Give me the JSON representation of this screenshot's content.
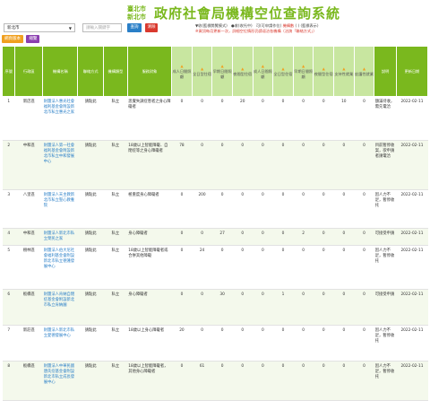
{
  "site": {
    "logo_line1": "臺北市",
    "logo_line2": "新北市",
    "title": "政府社會局機構空位查詢系統"
  },
  "filters": {
    "area_select": "新北市",
    "area_placeholder": "請輸入關鍵字",
    "query_button": "查詢",
    "clear_button": "清除"
  },
  "legend": {
    "line1_prefix": "▼收(藍標閱覽模式)　●收(收托中)　可(可申請作位)",
    "line1_red": "機構數",
    "line1_suffix": "( ) (藍標表示)",
    "line2": "※資訊每月更新一次，詳細空位情形仍請逕洽各機構（洽詢「聯絡方式」）"
  },
  "tags": {
    "tag1": "網頁版本",
    "tag2": "總覽"
  },
  "columns": [
    "序號",
    "行政區",
    "機構名稱",
    "聯絡方式",
    "機構類型",
    "服務對象",
    "成人日間照顧",
    "全日型住宿",
    "早期日間照顧",
    "夜間型住宿",
    "成人日間照顧",
    "全日型住宿",
    "早期日間照顧",
    "夜間型住宿",
    "支持性就業",
    "庇護性就業",
    "說明",
    "更新日期"
  ],
  "rows": [
    {
      "no": "1",
      "district": "新店區",
      "org": "財團法人惠光社會福利基金會附設新北市私立惠光之家",
      "contact": "請點此",
      "type": "私立",
      "target": "思覺失調症患者之身心障礙者",
      "c1": "0",
      "c2": "0",
      "c3": "0",
      "c4": "20",
      "c5": "0",
      "c6": "0",
      "c7": "0",
      "c8": "0",
      "c9": "10",
      "c10": "0",
      "note": "額滿待收，需先電洽",
      "date": "2022-02-11"
    },
    {
      "no": "2",
      "district": "中和區",
      "org": "財團法人第一社會福利基金會附設新北市私立中和發展中心",
      "contact": "請點此",
      "type": "私立",
      "target": "18歲以上智能障礙、自閉症等之身心障礙者",
      "c1": "78",
      "c2": "0",
      "c3": "0",
      "c4": "0",
      "c5": "0",
      "c6": "0",
      "c7": "0",
      "c8": "0",
      "c9": "0",
      "c10": "0",
      "note": "目前暫停收案，欲申請者請電洽",
      "date": "2022-02-11"
    },
    {
      "no": "3",
      "district": "八里區",
      "org": "財團法人天主教新北市私立聖心教養院",
      "contact": "請點此",
      "type": "私立",
      "target": "極重度身心障礙者",
      "c1": "0",
      "c2": "200",
      "c3": "0",
      "c4": "0",
      "c5": "0",
      "c6": "0",
      "c7": "0",
      "c8": "0",
      "c9": "0",
      "c10": "0",
      "note": "因人力不足，暫停收托",
      "date": "2022-02-11"
    },
    {
      "no": "4",
      "district": "中和區",
      "org": "財團法人新北市私立榮民之家",
      "contact": "請點此",
      "type": "私立",
      "target": "身心障礙者",
      "c1": "0",
      "c2": "0",
      "c3": "27",
      "c4": "0",
      "c5": "0",
      "c6": "0",
      "c7": "2",
      "c8": "0",
      "c9": "0",
      "c10": "0",
      "note": "可接受申請",
      "date": "2022-02-11"
    },
    {
      "no": "5",
      "district": "樹林區",
      "org": "財團法人伯大尼社會福利基金會附設新北市私立德蓮發展中心",
      "contact": "請點此",
      "type": "私立",
      "target": "18歲以上智能障礙者或合併其他障礙",
      "c1": "0",
      "c2": "24",
      "c3": "0",
      "c4": "0",
      "c5": "0",
      "c6": "0",
      "c7": "0",
      "c8": "0",
      "c9": "0",
      "c10": "0",
      "note": "因人力不足，暫停收托",
      "date": "2022-02-11"
    },
    {
      "no": "6",
      "district": "板橋區",
      "org": "財團法人肯納自閉症基金會附設新北市私立肯納園",
      "contact": "請點此",
      "type": "私立",
      "target": "身心障礙者",
      "c1": "0",
      "c2": "0",
      "c3": "30",
      "c4": "0",
      "c5": "0",
      "c6": "1",
      "c7": "0",
      "c8": "0",
      "c9": "0",
      "c10": "0",
      "note": "可接受申請",
      "date": "2022-02-11"
    },
    {
      "no": "7",
      "district": "新莊區",
      "org": "財團法人新北市私立愛德發展中心",
      "contact": "請點此",
      "type": "私立",
      "target": "18歲以上身心障礙者",
      "c1": "20",
      "c2": "0",
      "c3": "0",
      "c4": "0",
      "c5": "0",
      "c6": "0",
      "c7": "0",
      "c8": "0",
      "c9": "0",
      "c10": "0",
      "note": "因人力不足，暫停收托",
      "date": "2022-02-11"
    },
    {
      "no": "8",
      "district": "板橋區",
      "org": "財團法人中華民國唐氏症基金會附設新北市私立成長發展中心",
      "contact": "請點此",
      "type": "私立",
      "target": "18歲以上智能障礙者，其他身心障礙者",
      "c1": "0",
      "c2": "61",
      "c3": "0",
      "c4": "0",
      "c5": "0",
      "c6": "0",
      "c7": "0",
      "c8": "0",
      "c9": "0",
      "c10": "0",
      "note": "因人力不足，暫停收托",
      "date": "2022-02-11"
    }
  ]
}
